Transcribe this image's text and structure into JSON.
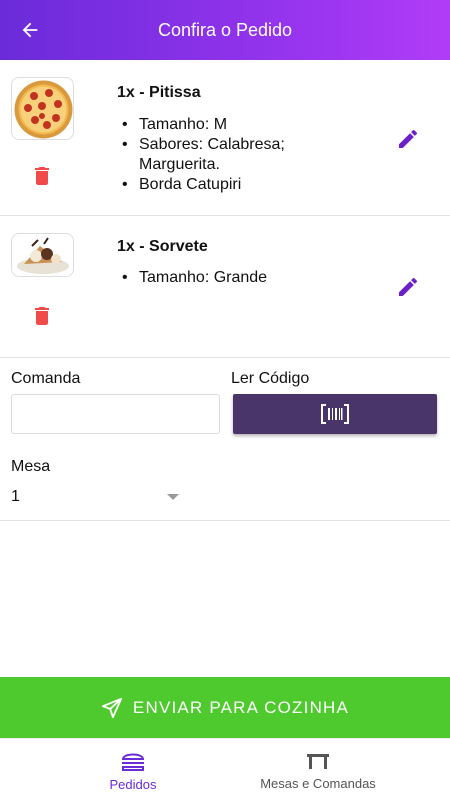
{
  "header": {
    "title": "Confira o Pedido",
    "back_icon": "arrow-left-icon"
  },
  "items": [
    {
      "title": "1x - Pitissa",
      "details": [
        "Tamanho: M",
        "Sabores: Calabresa; Marguerita.",
        "Borda Catupiri"
      ]
    },
    {
      "title": "1x - Sorvete",
      "details": [
        "Tamanho: Grande"
      ]
    }
  ],
  "form": {
    "comanda_label": "Comanda",
    "comanda_value": "",
    "codigo_label": "Ler Código",
    "mesa_label": "Mesa",
    "mesa_value": "1"
  },
  "send_button": {
    "label": "ENVIAR PARA COZINHA"
  },
  "bottom_nav": {
    "pedidos": "Pedidos",
    "mesas": "Mesas e Comandas"
  },
  "colors": {
    "header_start": "#6a2bd9",
    "header_end": "#b13cf7",
    "delete": "#f04a4a",
    "edit": "#6a1fc8",
    "scan_button": "#4a356a",
    "send_button": "#4fca2e",
    "nav_active": "#6a2bd9"
  }
}
